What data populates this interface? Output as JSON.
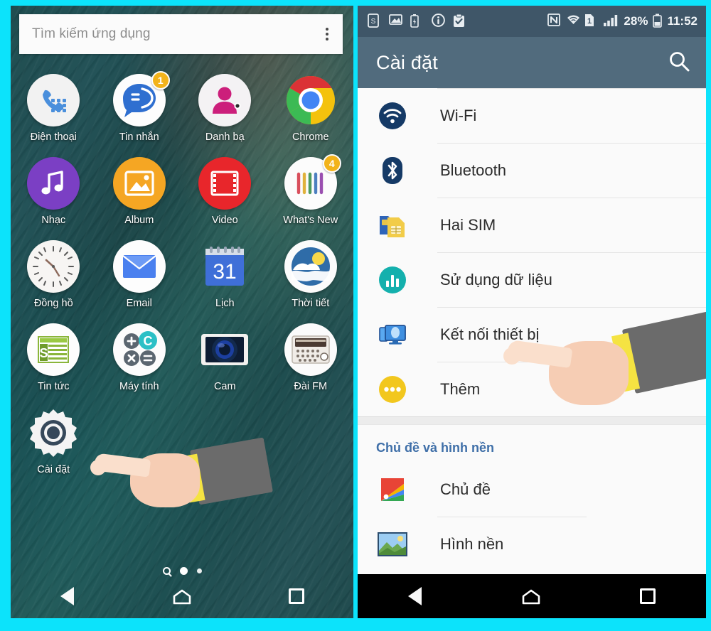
{
  "theme": {
    "border_color": "#0ce3fb",
    "settings_appbar_color": "#516b7d",
    "statusbar_color": "#3f5668",
    "accent_link_color": "#3f6fa8",
    "badge_color": "#f2b31b"
  },
  "home": {
    "search": {
      "placeholder": "Tìm kiếm ứng dụng",
      "overflow_icon": "kebab-menu-icon"
    },
    "apps": [
      {
        "label": "Điện thoại",
        "icon": "phone-dialer-icon",
        "badge": null
      },
      {
        "label": "Tin nhắn",
        "icon": "messaging-icon",
        "badge": "1"
      },
      {
        "label": "Danh bạ",
        "icon": "contacts-icon",
        "badge": null
      },
      {
        "label": "Chrome",
        "icon": "chrome-icon",
        "badge": null
      },
      {
        "label": "Nhạc",
        "icon": "music-icon",
        "badge": null
      },
      {
        "label": "Album",
        "icon": "album-gallery-icon",
        "badge": null
      },
      {
        "label": "Video",
        "icon": "video-icon",
        "badge": null
      },
      {
        "label": "What's New",
        "icon": "whats-new-icon",
        "badge": "4"
      },
      {
        "label": "Đồng hồ",
        "icon": "clock-icon",
        "badge": null
      },
      {
        "label": "Email",
        "icon": "email-icon",
        "badge": null
      },
      {
        "label": "Lịch",
        "icon": "calendar-icon",
        "badge": null,
        "day": "31"
      },
      {
        "label": "Thời tiết",
        "icon": "weather-icon",
        "badge": null
      },
      {
        "label": "Tin tức",
        "icon": "news-icon",
        "badge": null
      },
      {
        "label": "Máy tính",
        "icon": "calculator-icon",
        "badge": null
      },
      {
        "label": "Cam",
        "icon": "camera-icon",
        "badge": null
      },
      {
        "label": "Đài FM",
        "icon": "fm-radio-icon",
        "badge": null
      },
      {
        "label": "Cài đặt",
        "icon": "settings-gear-icon",
        "badge": null
      }
    ],
    "page_indicator": {
      "search_dot": "search-icon",
      "dots": 2,
      "active_index": 0
    },
    "navbar": {
      "back": "back-triangle-icon",
      "home": "home-icon",
      "recents": "recents-square-icon"
    }
  },
  "settings": {
    "statusbar": {
      "left_icons": [
        "sim-card-status-icon",
        "screenshot-image-icon",
        "battery-saver-icon",
        "info-circle-icon",
        "clipboard-check-icon"
      ],
      "right_icons": [
        "nfc-icon",
        "wifi-icon",
        "sim-1-icon",
        "signal-bars-icon"
      ],
      "battery_percent": "28%",
      "battery_icon": "battery-icon",
      "time": "11:52"
    },
    "appbar": {
      "title": "Cài đặt",
      "search_icon": "search-icon"
    },
    "groups": [
      {
        "header": null,
        "items": [
          {
            "label": "Wi-Fi",
            "icon": "wifi-settings-icon"
          },
          {
            "label": "Bluetooth",
            "icon": "bluetooth-icon"
          },
          {
            "label": "Hai SIM",
            "icon": "dual-sim-icon"
          },
          {
            "label": "Sử dụng dữ liệu",
            "icon": "data-usage-icon"
          },
          {
            "label": "Kết nối thiết bị",
            "icon": "device-connection-icon"
          },
          {
            "label": "Thêm",
            "icon": "more-dots-icon"
          }
        ]
      },
      {
        "header": "Chủ đề và hình nền",
        "items": [
          {
            "label": "Chủ đề",
            "icon": "theme-palette-icon"
          },
          {
            "label": "Hình nền",
            "icon": "wallpaper-icon"
          }
        ]
      }
    ],
    "navbar": {
      "back": "back-triangle-icon",
      "home": "home-icon",
      "recents": "recents-square-icon"
    }
  }
}
